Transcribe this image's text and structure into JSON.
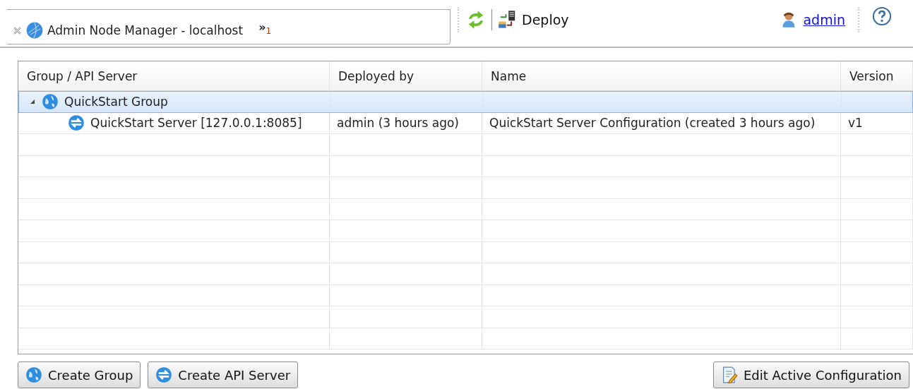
{
  "tab": {
    "title": "Admin Node Manager - localhost",
    "overflow": "»",
    "overflow_count": "1"
  },
  "toolbar": {
    "deploy": "Deploy",
    "user": "admin"
  },
  "table": {
    "columns": [
      "Group / API Server",
      "Deployed by",
      "Name",
      "Version"
    ],
    "rows": [
      {
        "kind": "group",
        "label": "QuickStart Group",
        "selected": true,
        "expanded": true,
        "children": [
          {
            "kind": "server",
            "label": "QuickStart Server [127.0.0.1:8085]",
            "deployed_by": "admin (3 hours ago)",
            "name": "QuickStart Server Configuration (created 3 hours ago)",
            "version": "v1",
            "selected": false
          }
        ]
      }
    ]
  },
  "buttons": [
    {
      "kind": "group",
      "label": "Create Group"
    },
    {
      "kind": "server",
      "label": "Create API Server"
    },
    {
      "kind": "edit",
      "label": "Edit Active Configuration"
    }
  ]
}
